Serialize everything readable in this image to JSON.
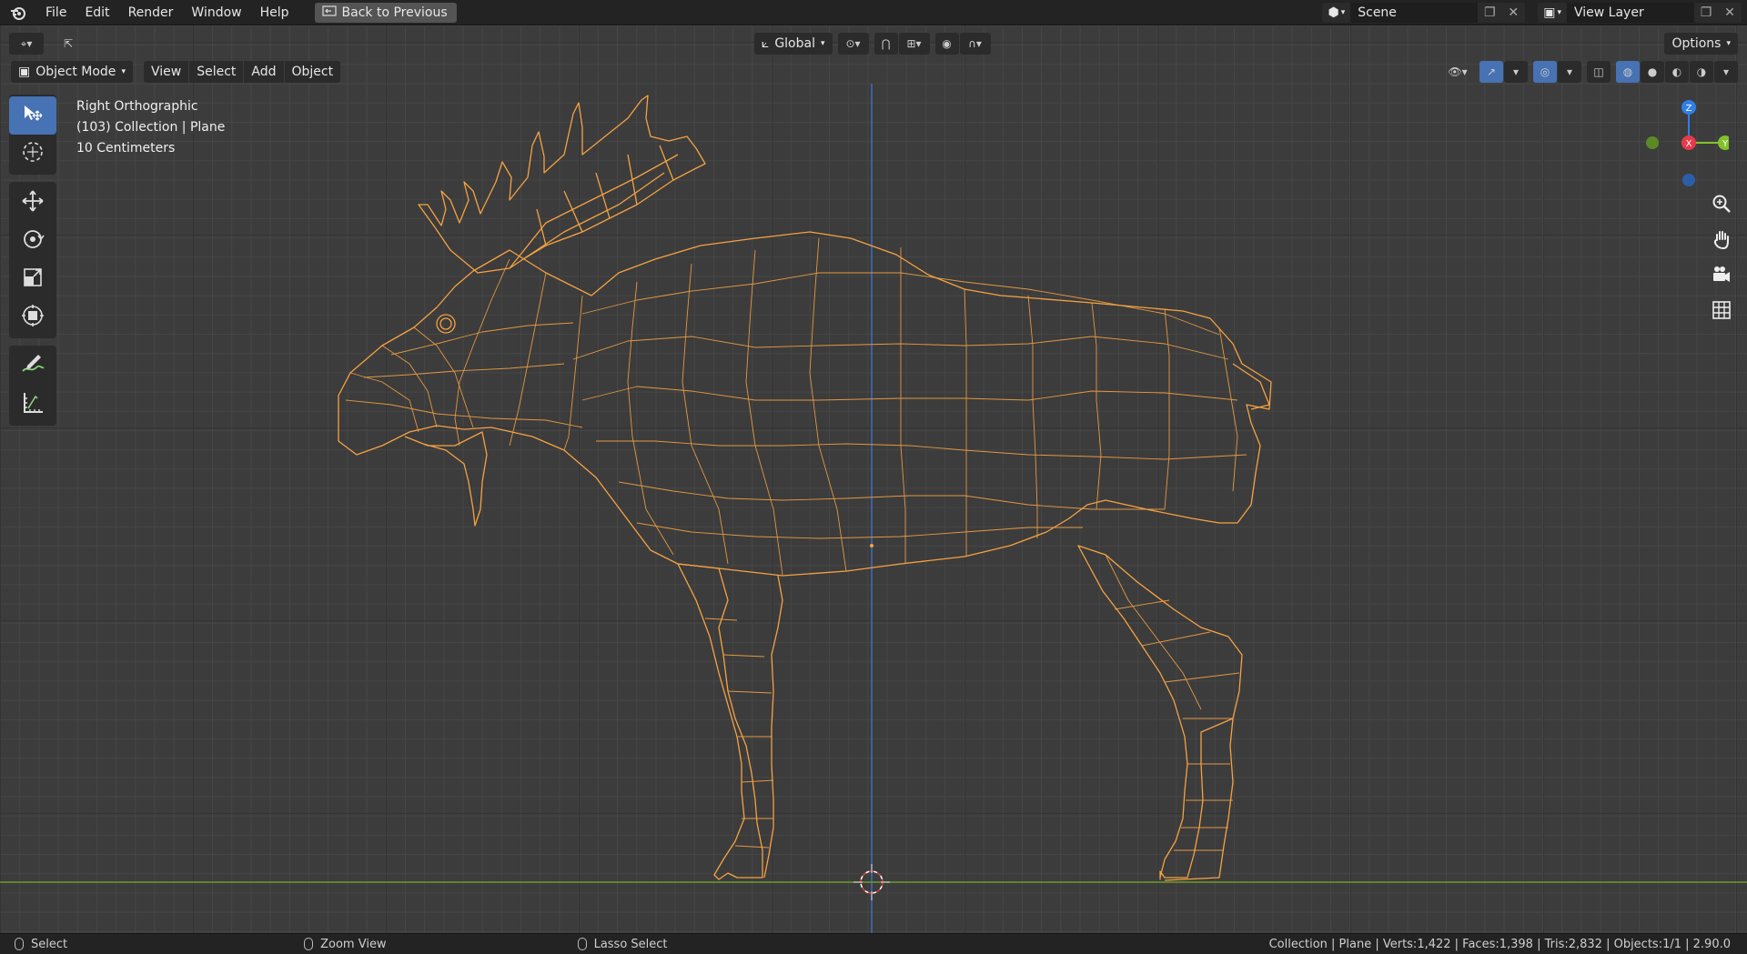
{
  "topbar": {
    "menus": [
      "File",
      "Edit",
      "Render",
      "Window",
      "Help"
    ],
    "back_button": "Back to Previous",
    "scene_name": "Scene",
    "view_layer_name": "View Layer"
  },
  "header": {
    "transform_orientation": "Global",
    "options_label": "Options",
    "mode": "Object Mode",
    "menus": [
      "View",
      "Select",
      "Add",
      "Object"
    ]
  },
  "viewport_info": {
    "view_name": "Right Orthographic",
    "collection_line": "(103) Collection | Plane",
    "scale_line": "10 Centimeters"
  },
  "gizmo": {
    "axes": [
      "Z",
      "X",
      "Y"
    ],
    "colors": {
      "x": "#e8394a",
      "y": "#82c12c",
      "z": "#2f7fe6"
    }
  },
  "tools": [
    "select-box",
    "cursor",
    "move",
    "rotate",
    "scale",
    "transform",
    "annotate",
    "measure"
  ],
  "nav_buttons": [
    "zoom",
    "pan",
    "camera",
    "ortho-toggle"
  ],
  "statusbar": {
    "select_label": "Select",
    "zoom_label": "Zoom View",
    "lasso_label": "Lasso Select",
    "stats": "Collection | Plane | Verts:1,422 | Faces:1,398 | Tris:2,832 | Objects:1/1 | 2.90.0"
  },
  "colors": {
    "accent": "#4772b3",
    "wireframe": "#f5a243",
    "background": "#3c3c3c"
  }
}
